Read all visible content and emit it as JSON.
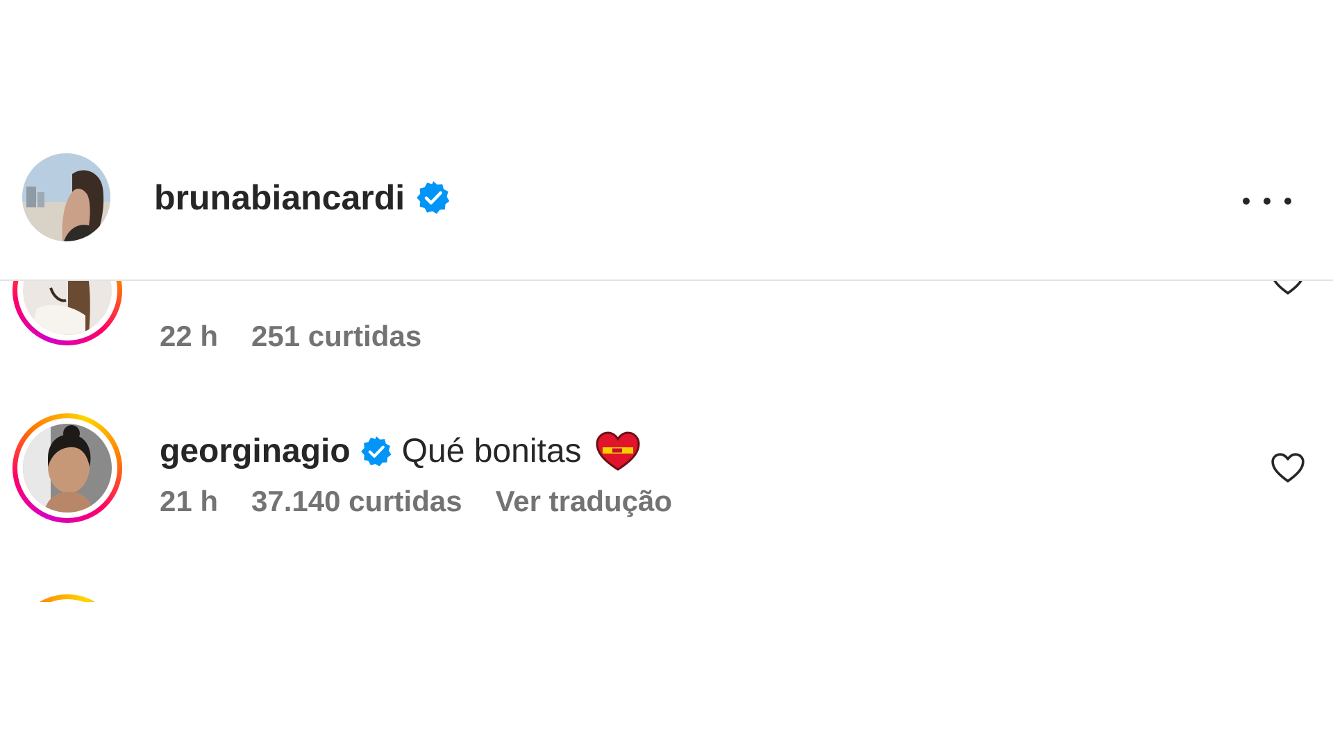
{
  "header": {
    "username": "brunabiancardi",
    "more_icon": "more-horizontal-icon",
    "verified_icon": "verified-badge-icon"
  },
  "comments": [
    {
      "time": "22 h",
      "likes": "251 curtidas",
      "like_icon": "heart-outline-icon"
    },
    {
      "username": "georginagio",
      "text": "Qué bonitas",
      "emoji": "heart-on-fire-emoji",
      "time": "21 h",
      "likes": "37.140 curtidas",
      "translate": "Ver tradução",
      "like_icon": "heart-outline-icon"
    }
  ],
  "colors": {
    "text": "#262626",
    "muted": "#737373",
    "verified": "#0095f6",
    "divider": "#e3e3e3"
  }
}
